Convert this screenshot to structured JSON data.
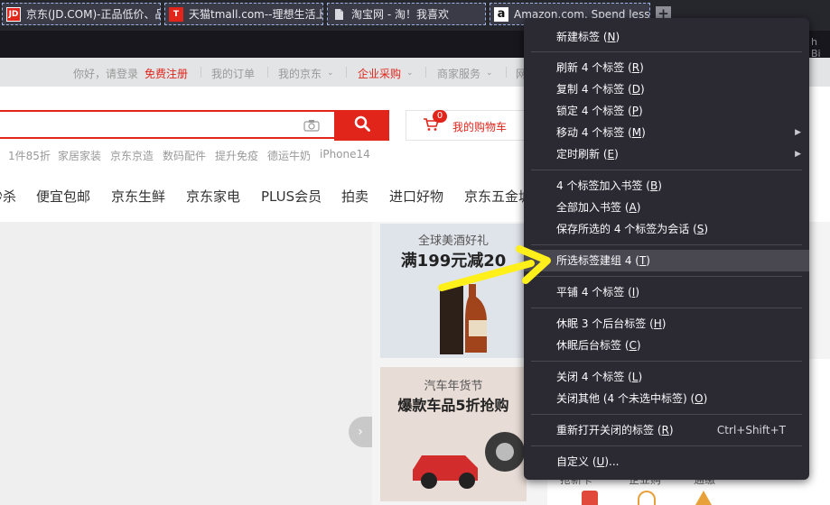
{
  "tabs": [
    {
      "title": "京东(JD.COM)-正品低价、品",
      "favicon": "JD"
    },
    {
      "title": "天猫tmall.com--理想生活上",
      "favicon": "T"
    },
    {
      "title": "淘宝网 - 淘！我喜欢",
      "favicon": "doc"
    },
    {
      "title": "Amazon.com. Spend less. S",
      "favicon": "a"
    }
  ],
  "new_tab": "+",
  "bookmarks_partial": "h Bi",
  "site": {
    "toplinks": [
      "你好，请登录",
      "免费注册",
      "我的订单",
      "我的京东",
      "企业采购",
      "商家服务",
      "网"
    ],
    "cart_label": "我的购物车",
    "cart_count": "0",
    "hot_words": [
      "1件85折",
      "家居家装",
      "京东京造",
      "数码配件",
      "提升免疫",
      "德运牛奶",
      "iPhone14"
    ],
    "nav": [
      "秒杀",
      "便宜包邮",
      "京东生鲜",
      "京东家电",
      "PLUS会员",
      "拍卖",
      "进口好物",
      "京东五金城"
    ],
    "promo1": {
      "title": "全球美酒好礼",
      "headline": "满199元减20"
    },
    "promo2": {
      "title": "汽车年货节",
      "headline": "爆款车品5折抢购"
    },
    "bottom_labels": [
      "抢新卡",
      "企业购",
      "通缴"
    ],
    "arrow": "›"
  },
  "menu": {
    "new_tab": {
      "text": "新建标签",
      "key": "N"
    },
    "reload": {
      "text": "刷新 4 个标签",
      "key": "R"
    },
    "duplicate": {
      "text": "复制 4 个标签",
      "key": "D"
    },
    "pin": {
      "text": "锁定 4 个标签",
      "key": "P"
    },
    "move": {
      "text": "移动 4 个标签",
      "key": "M"
    },
    "timed_reload": {
      "text": "定时刷新",
      "key": "E"
    },
    "bookmark": {
      "text": "4 个标签加入书签",
      "key": "B"
    },
    "bookmark_all": {
      "text": "全部加入书签",
      "key": "A"
    },
    "save_session": {
      "text": "保存所选的 4 个标签为会话",
      "key": "S"
    },
    "group": {
      "text": "所选标签建组 4",
      "key": "T"
    },
    "tile": {
      "text": "平铺 4 个标签",
      "key": "I"
    },
    "hibernate_bg3": {
      "text": "休眠 3 个后台标签",
      "key": "H"
    },
    "hibernate_bg": {
      "text": "休眠后台标签",
      "key": "C"
    },
    "close": {
      "text": "关闭 4 个标签",
      "key": "L"
    },
    "close_others": {
      "text": "关闭其他 (4 个未选中标签)",
      "key": "O"
    },
    "reopen": {
      "text": "重新打开关闭的标签",
      "key": "R",
      "shortcut": "Ctrl+Shift+T"
    },
    "customize": {
      "text": "自定义",
      "key": "U",
      "suffix": "..."
    }
  },
  "colors": {
    "menu_bg": "#2b2a33",
    "highlight": "#494851",
    "jd_red": "#e1251b",
    "annotation": "#ffef1a"
  }
}
